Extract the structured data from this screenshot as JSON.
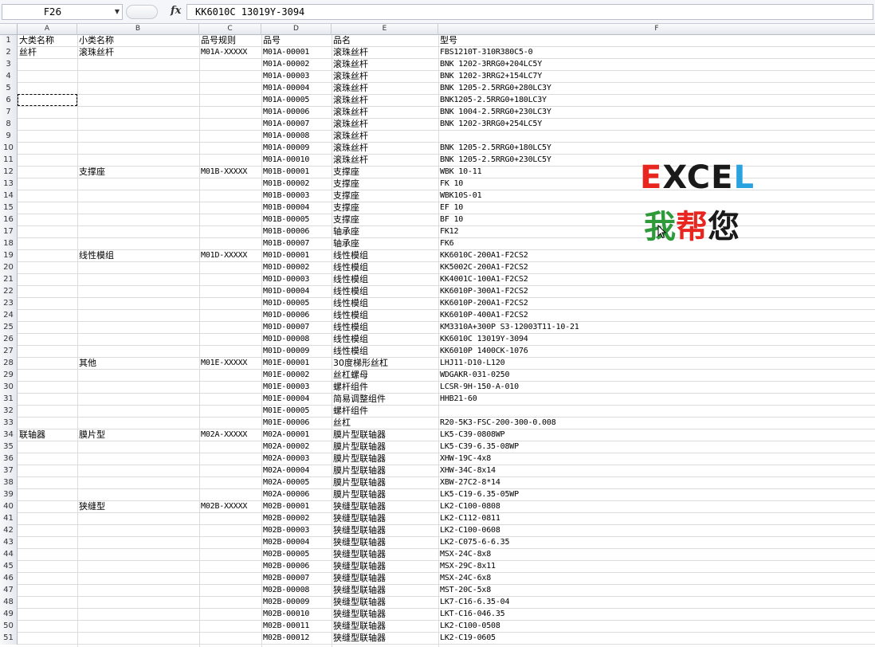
{
  "namebox": {
    "value": "F26"
  },
  "formula": {
    "fx_label": "fx",
    "value": "KK6010C 13019Y-3094"
  },
  "columns": [
    "A",
    "B",
    "C",
    "D",
    "E",
    "F"
  ],
  "headers": {
    "a": "大类名称",
    "b": "小类名称",
    "c": "品号规则",
    "d": "品号",
    "e": "品名",
    "f": "型号"
  },
  "rows": [
    {
      "n": "2",
      "a": "丝杆",
      "b": "滚珠丝杆",
      "c": "M01A-XXXXX",
      "d": "M01A-00001",
      "e": "滚珠丝杆",
      "f": "FBS1210T-310R380C5-0"
    },
    {
      "n": "3",
      "a": "",
      "b": "",
      "c": "",
      "d": "M01A-00002",
      "e": "滚珠丝杆",
      "f": "BNK 1202-3RRG0+204LC5Y"
    },
    {
      "n": "4",
      "a": "",
      "b": "",
      "c": "",
      "d": "M01A-00003",
      "e": "滚珠丝杆",
      "f": "BNK 1202-3RRG2+154LC7Y"
    },
    {
      "n": "5",
      "a": "",
      "b": "",
      "c": "",
      "d": "M01A-00004",
      "e": "滚珠丝杆",
      "f": "BNK 1205-2.5RRG0+280LC3Y"
    },
    {
      "n": "6",
      "a": "",
      "b": "",
      "c": "",
      "d": "M01A-00005",
      "e": "滚珠丝杆",
      "f": "BNK1205-2.5RRG0+180LC3Y"
    },
    {
      "n": "7",
      "a": "",
      "b": "",
      "c": "",
      "d": "M01A-00006",
      "e": "滚珠丝杆",
      "f": "BNK 1004-2.5RRG0+230LC3Y"
    },
    {
      "n": "8",
      "a": "",
      "b": "",
      "c": "",
      "d": "M01A-00007",
      "e": "滚珠丝杆",
      "f": "BNK 1202-3RRG0+254LC5Y"
    },
    {
      "n": "9",
      "a": "",
      "b": "",
      "c": "",
      "d": "M01A-00008",
      "e": "滚珠丝杆",
      "f": ""
    },
    {
      "n": "10",
      "a": "",
      "b": "",
      "c": "",
      "d": "M01A-00009",
      "e": "滚珠丝杆",
      "f": "BNK 1205-2.5RRG0+180LC5Y"
    },
    {
      "n": "11",
      "a": "",
      "b": "",
      "c": "",
      "d": "M01A-00010",
      "e": "滚珠丝杆",
      "f": "BNK 1205-2.5RRG0+230LC5Y"
    },
    {
      "n": "12",
      "a": "",
      "b": "支撑座",
      "c": "M01B-XXXXX",
      "d": "M01B-00001",
      "e": "支撑座",
      "f": "WBK 10-11"
    },
    {
      "n": "13",
      "a": "",
      "b": "",
      "c": "",
      "d": "M01B-00002",
      "e": "支撑座",
      "f": "FK 10"
    },
    {
      "n": "14",
      "a": "",
      "b": "",
      "c": "",
      "d": "M01B-00003",
      "e": "支撑座",
      "f": "WBK10S-01"
    },
    {
      "n": "15",
      "a": "",
      "b": "",
      "c": "",
      "d": "M01B-00004",
      "e": "支撑座",
      "f": "EF 10"
    },
    {
      "n": "16",
      "a": "",
      "b": "",
      "c": "",
      "d": "M01B-00005",
      "e": "支撑座",
      "f": "BF 10"
    },
    {
      "n": "17",
      "a": "",
      "b": "",
      "c": "",
      "d": "M01B-00006",
      "e": "轴承座",
      "f": "FK12"
    },
    {
      "n": "18",
      "a": "",
      "b": "",
      "c": "",
      "d": "M01B-00007",
      "e": "轴承座",
      "f": "FK6"
    },
    {
      "n": "19",
      "a": "",
      "b": "线性模组",
      "c": "M01D-XXXXX",
      "d": "M01D-00001",
      "e": "线性模组",
      "f": "KK6010C-200A1-F2CS2"
    },
    {
      "n": "20",
      "a": "",
      "b": "",
      "c": "",
      "d": "M01D-00002",
      "e": "线性模组",
      "f": "KK5002C-200A1-F2CS2"
    },
    {
      "n": "21",
      "a": "",
      "b": "",
      "c": "",
      "d": "M01D-00003",
      "e": "线性模组",
      "f": "KK4001C-100A1-F2CS2"
    },
    {
      "n": "22",
      "a": "",
      "b": "",
      "c": "",
      "d": "M01D-00004",
      "e": "线性模组",
      "f": "KK6010P-300A1-F2CS2"
    },
    {
      "n": "23",
      "a": "",
      "b": "",
      "c": "",
      "d": "M01D-00005",
      "e": "线性模组",
      "f": "KK6010P-200A1-F2CS2"
    },
    {
      "n": "24",
      "a": "",
      "b": "",
      "c": "",
      "d": "M01D-00006",
      "e": "线性模组",
      "f": "KK6010P-400A1-F2CS2"
    },
    {
      "n": "25",
      "a": "",
      "b": "",
      "c": "",
      "d": "M01D-00007",
      "e": "线性模组",
      "f": "KM3310A+300P S3-12003T11-10-21"
    },
    {
      "n": "26",
      "a": "",
      "b": "",
      "c": "",
      "d": "M01D-00008",
      "e": "线性模组",
      "f": "KK6010C 13019Y-3094"
    },
    {
      "n": "27",
      "a": "",
      "b": "",
      "c": "",
      "d": "M01D-00009",
      "e": "线性模组",
      "f": "KK6010P 1400CK-1076"
    },
    {
      "n": "28",
      "a": "",
      "b": "其他",
      "c": "M01E-XXXXX",
      "d": "M01E-00001",
      "e": "30度梯形丝杠",
      "f": "LHJ11-D10-L120"
    },
    {
      "n": "29",
      "a": "",
      "b": "",
      "c": "",
      "d": "M01E-00002",
      "e": "丝杠螺母",
      "f": "WDGAKR-031-0250"
    },
    {
      "n": "30",
      "a": "",
      "b": "",
      "c": "",
      "d": "M01E-00003",
      "e": "螺杆组件",
      "f": "LCSR-9H-150-A-010"
    },
    {
      "n": "31",
      "a": "",
      "b": "",
      "c": "",
      "d": "M01E-00004",
      "e": "简易调整组件",
      "f": "HHB21-60"
    },
    {
      "n": "32",
      "a": "",
      "b": "",
      "c": "",
      "d": "M01E-00005",
      "e": "螺杆组件",
      "f": ""
    },
    {
      "n": "33",
      "a": "",
      "b": "",
      "c": "",
      "d": "M01E-00006",
      "e": "丝杠",
      "f": "R20-5K3-FSC-200-300-0.008"
    },
    {
      "n": "34",
      "a": "联轴器",
      "b": "膜片型",
      "c": "M02A-XXXXX",
      "d": "M02A-00001",
      "e": "膜片型联轴器",
      "f": "LK5-C39-0808WP"
    },
    {
      "n": "35",
      "a": "",
      "b": "",
      "c": "",
      "d": "M02A-00002",
      "e": "膜片型联轴器",
      "f": "LK5-C39-6.35-08WP"
    },
    {
      "n": "36",
      "a": "",
      "b": "",
      "c": "",
      "d": "M02A-00003",
      "e": "膜片型联轴器",
      "f": "XHW-19C-4x8"
    },
    {
      "n": "37",
      "a": "",
      "b": "",
      "c": "",
      "d": "M02A-00004",
      "e": "膜片型联轴器",
      "f": "XHW-34C-8x14"
    },
    {
      "n": "38",
      "a": "",
      "b": "",
      "c": "",
      "d": "M02A-00005",
      "e": "膜片型联轴器",
      "f": "XBW-27C2-8*14"
    },
    {
      "n": "39",
      "a": "",
      "b": "",
      "c": "",
      "d": "M02A-00006",
      "e": "膜片型联轴器",
      "f": "LK5-C19-6.35-05WP"
    },
    {
      "n": "40",
      "a": "",
      "b": "狭缝型",
      "c": "M02B-XXXXX",
      "d": "M02B-00001",
      "e": "狭缝型联轴器",
      "f": "LK2-C100-0808"
    },
    {
      "n": "41",
      "a": "",
      "b": "",
      "c": "",
      "d": "M02B-00002",
      "e": "狭缝型联轴器",
      "f": "LK2-C112-0811"
    },
    {
      "n": "42",
      "a": "",
      "b": "",
      "c": "",
      "d": "M02B-00003",
      "e": "狭缝型联轴器",
      "f": "LK2-C100-0608"
    },
    {
      "n": "43",
      "a": "",
      "b": "",
      "c": "",
      "d": "M02B-00004",
      "e": "狭缝型联轴器",
      "f": "LK2-C075-6-6.35"
    },
    {
      "n": "44",
      "a": "",
      "b": "",
      "c": "",
      "d": "M02B-00005",
      "e": "狭缝型联轴器",
      "f": "MSX-24C-8x8"
    },
    {
      "n": "45",
      "a": "",
      "b": "",
      "c": "",
      "d": "M02B-00006",
      "e": "狭缝型联轴器",
      "f": "MSX-29C-8x11"
    },
    {
      "n": "46",
      "a": "",
      "b": "",
      "c": "",
      "d": "M02B-00007",
      "e": "狭缝型联轴器",
      "f": "MSX-24C-6x8"
    },
    {
      "n": "47",
      "a": "",
      "b": "",
      "c": "",
      "d": "M02B-00008",
      "e": "狭缝型联轴器",
      "f": "MST-20C-5x8"
    },
    {
      "n": "48",
      "a": "",
      "b": "",
      "c": "",
      "d": "M02B-00009",
      "e": "狭缝型联轴器",
      "f": "LK7-C16-6.35-04"
    },
    {
      "n": "49",
      "a": "",
      "b": "",
      "c": "",
      "d": "M02B-00010",
      "e": "狭缝型联轴器",
      "f": "LKT-C16-046.35"
    },
    {
      "n": "50",
      "a": "",
      "b": "",
      "c": "",
      "d": "M02B-00011",
      "e": "狭缝型联轴器",
      "f": "LK2-C100-0508"
    },
    {
      "n": "51",
      "a": "",
      "b": "",
      "c": "",
      "d": "M02B-00012",
      "e": "狭缝型联轴器",
      "f": "LK2-C19-0605"
    }
  ],
  "logo": {
    "word": "EXCEL",
    "word_colors": [
      "#e8251f",
      "#1a1a1a",
      "#1a1a1a",
      "#1a1a1a",
      "#29a3e0"
    ],
    "cn": "我帮您",
    "cn_colors": [
      "#2e9a3a",
      "#e8251f",
      "#1a1a1a"
    ]
  },
  "colors": {
    "gridline": "#dadcdd",
    "header_bg": "#e4e8ee"
  }
}
